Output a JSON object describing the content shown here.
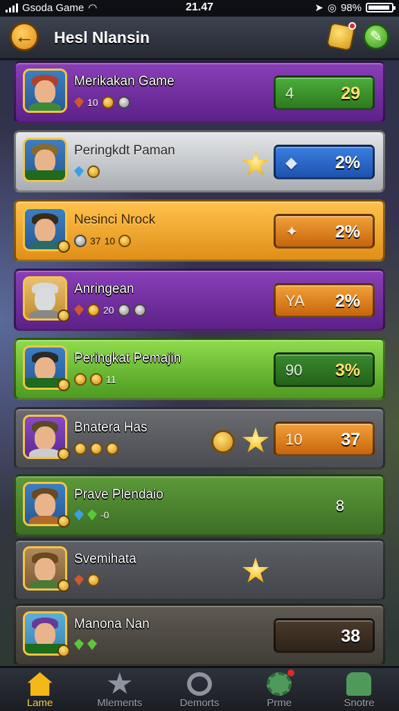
{
  "status_bar": {
    "carrier": "Gsoda Game",
    "time": "21.47",
    "battery": "98%"
  },
  "header": {
    "title": "Hesl Nlansin"
  },
  "players": [
    {
      "name": "Merikakan Game",
      "stats": [
        "10"
      ],
      "score_left": "4",
      "score": "29"
    },
    {
      "name": "Peringkdt Paman",
      "stats": [],
      "score_left": "",
      "score": "2%"
    },
    {
      "name": "Nesinci Nrock",
      "stats": [
        "37",
        "10"
      ],
      "score_left": "",
      "score": "2%"
    },
    {
      "name": "Anringean",
      "stats": [
        "20"
      ],
      "score_left": "YA",
      "score": "2%"
    },
    {
      "name": "Peringkat Pemajin",
      "stats": [
        "11"
      ],
      "score_left": "90",
      "score": "3%"
    },
    {
      "name": "Bnatera Has",
      "stats": [],
      "score_left": "10",
      "score": "37"
    },
    {
      "name": "Prave Plendaio",
      "stats": [
        "-0"
      ],
      "score_left": "",
      "score": "8"
    },
    {
      "name": "Svemihata",
      "stats": [],
      "score_left": "",
      "score": ""
    },
    {
      "name": "Manona Nan",
      "stats": [],
      "score_left": "",
      "score": "38"
    }
  ],
  "nav": [
    {
      "label": "Lame",
      "icon": "home-icon"
    },
    {
      "label": "Mlements",
      "icon": "star-icon"
    },
    {
      "label": "Demorts",
      "icon": "ring-icon"
    },
    {
      "label": "Prme",
      "icon": "gear-icon"
    },
    {
      "label": "Snotre",
      "icon": "shop-icon"
    }
  ]
}
